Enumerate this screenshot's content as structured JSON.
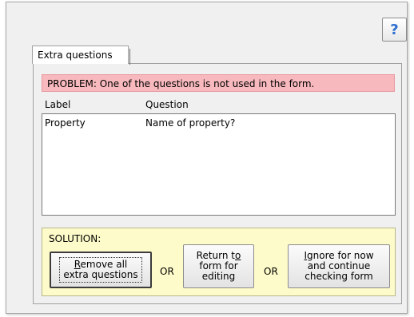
{
  "help": {
    "label": "?"
  },
  "tab": {
    "label": "Extra questions"
  },
  "problem": {
    "text": "PROBLEM:  One of the questions is not used in the form."
  },
  "columns": {
    "label": "Label",
    "question": "Question"
  },
  "rows": [
    {
      "label": "Property",
      "question": "Name of property?"
    }
  ],
  "solution": {
    "title": "SOLUTION:",
    "or_text": "OR",
    "remove": {
      "pre": "",
      "ul": "R",
      "post": "emove all",
      "line2": "extra questions"
    },
    "return": {
      "line1_pre": "Return t",
      "line1_ul": "o",
      "line2": "form for",
      "line3": "editing"
    },
    "ignore": {
      "ul": "I",
      "line1_post": "gnore for now",
      "line2": "and continue",
      "line3": "checking form"
    }
  },
  "colors": {
    "problem_bg": "#f7b9bd",
    "solution_bg": "#fdfbc9",
    "help_accent": "#2f6fd0"
  }
}
